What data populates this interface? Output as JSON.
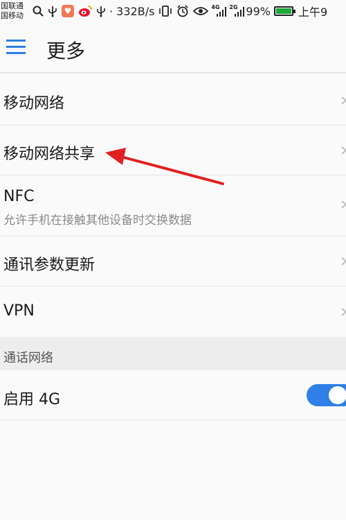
{
  "status_bar": {
    "carrier_1": "国联通",
    "carrier_2": "国移动",
    "speed": "· 332B/s",
    "net_4g": "4G",
    "net_2g": "2G",
    "battery": "99%",
    "battery_level": 0.99,
    "time": "上午9",
    "icons": [
      "search-icon",
      "usb-icon",
      "heart-app-icon",
      "weibo-icon",
      "usb-icon",
      "vibrate-icon",
      "alarm-icon",
      "eye-icon",
      "signal-icon",
      "battery-icon"
    ]
  },
  "header": {
    "title": "更多"
  },
  "list": [
    {
      "title": "移动网络"
    },
    {
      "title": "移动网络共享"
    },
    {
      "title": "NFC",
      "subtitle": "允许手机在接触其他设备时交换数据"
    },
    {
      "title": "通讯参数更新"
    },
    {
      "title": "VPN"
    }
  ],
  "section": {
    "label": "通话网络"
  },
  "enable_4g": {
    "label": "启用 4G",
    "on": true
  },
  "colors": {
    "accent": "#2d7fe0",
    "annotation_arrow": "#e02020"
  }
}
